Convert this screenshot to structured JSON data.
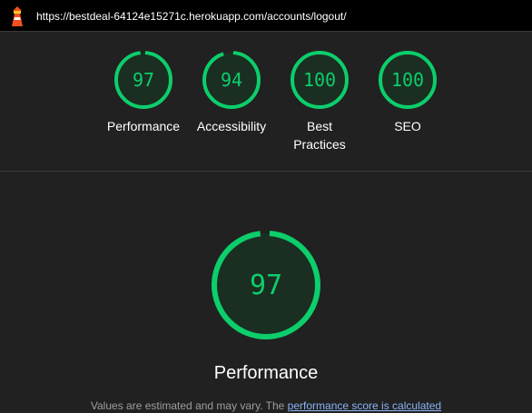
{
  "browser": {
    "url": "https://bestdeal-64124e15271c.herokuapp.com/accounts/logout/",
    "logo_icon": "lighthouse-icon"
  },
  "colors": {
    "pass": "#0cce6b",
    "pass_fill": "#1b2e22",
    "link": "#8ab4f8"
  },
  "gauges": [
    {
      "label": "Performance",
      "score": "97",
      "fraction": 0.97
    },
    {
      "label": "Accessibility",
      "score": "94",
      "fraction": 0.94
    },
    {
      "label": "Best Practices",
      "score": "100",
      "fraction": 1.0
    },
    {
      "label": "SEO",
      "score": "100",
      "fraction": 1.0
    }
  ],
  "main": {
    "score": "97",
    "fraction": 0.97,
    "title": "Performance",
    "note_text": "Values are estimated and may vary. The ",
    "note_link": "performance score is calculated"
  }
}
